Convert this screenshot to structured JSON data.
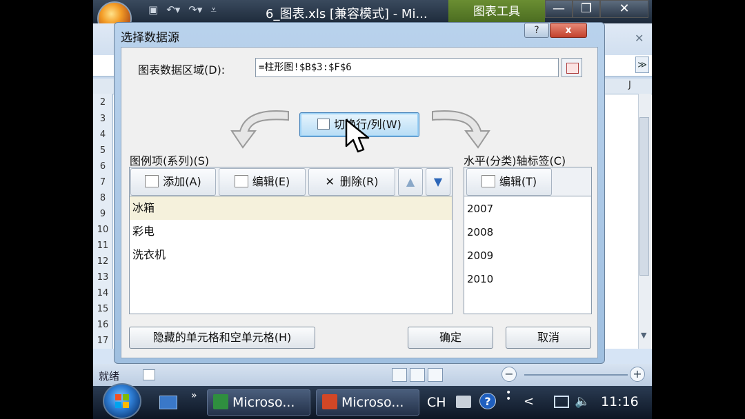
{
  "excel": {
    "title": "6_图表.xls [兼容模式] - Mi...",
    "chart_tools": "图表工具",
    "row_numbers": [
      "2",
      "3",
      "4",
      "5",
      "6",
      "7",
      "8",
      "9",
      "10",
      "11",
      "12",
      "13",
      "14",
      "15",
      "16",
      "17"
    ],
    "column_j": "J",
    "status": "就绪"
  },
  "dialog": {
    "title": "选择数据源",
    "help": "?",
    "close": "x",
    "range_label": "图表数据区域(D):",
    "range_value": "=柱形图!$B$3:$F$6",
    "switch_button": "切换行/列(W)",
    "series_label": "图例项(系列)(S)",
    "axis_label": "水平(分类)轴标签(C)",
    "series_toolbar": {
      "add": "添加(A)",
      "edit": "编辑(E)",
      "delete": "删除(R)"
    },
    "axis_toolbar": {
      "edit": "编辑(T)"
    },
    "series": [
      "冰箱",
      "彩电",
      "洗衣机"
    ],
    "categories": [
      "2007",
      "2008",
      "2009",
      "2010"
    ],
    "hidden_cells_button": "隐藏的单元格和空单元格(H)",
    "ok": "确定",
    "cancel": "取消"
  },
  "taskbar": {
    "task1": "Microso...",
    "task2": "Microso...",
    "lang": "CH",
    "help": "?",
    "clock": "11:16"
  },
  "icons": {
    "up": "up-arrow-icon",
    "down": "down-arrow-icon"
  }
}
